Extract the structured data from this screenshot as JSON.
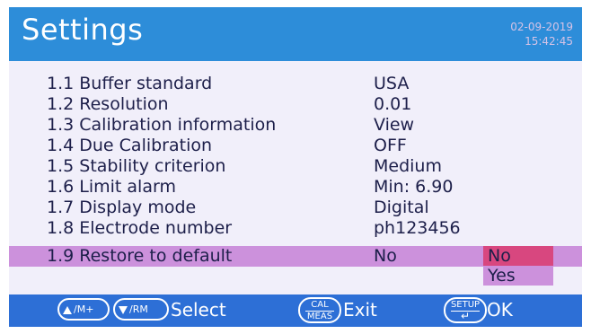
{
  "header": {
    "title": "Settings",
    "date": "02-09-2019",
    "time": "15:42:45"
  },
  "settings": [
    {
      "label": "1.1 Buffer standard",
      "value": "USA"
    },
    {
      "label": "1.2 Resolution",
      "value": "0.01"
    },
    {
      "label": "1.3 Calibration information",
      "value": "View"
    },
    {
      "label": "1.4 Due Calibration",
      "value": "OFF"
    },
    {
      "label": "1.5 Stability criterion",
      "value": "Medium"
    },
    {
      "label": "1.6 Limit alarm",
      "value": "Min: 6.90"
    },
    {
      "label": "1.7 Display mode",
      "value": "Digital"
    },
    {
      "label": "1.8 Electrode number",
      "value": "ph123456"
    },
    {
      "label": "1.9 Restore to default",
      "value": "No"
    }
  ],
  "dropdown": {
    "options": [
      "No",
      "Yes"
    ],
    "selected": "No"
  },
  "footer": {
    "up_key": "/M+",
    "down_key": "/RM",
    "select_label": "Select",
    "cal_key_top": "CAL",
    "cal_key_bottom": "MEAS",
    "exit_label": "Exit",
    "setup_key_top": "SETUP",
    "setup_key_bottom": "↵",
    "ok_label": "OK"
  },
  "colors": {
    "header_bg": "#2d8dd9",
    "screen_bg": "#f1effa",
    "highlight": "#cc91dc",
    "dropdown_selected": "#d8477f",
    "footer_bg": "#2d6fd6"
  }
}
